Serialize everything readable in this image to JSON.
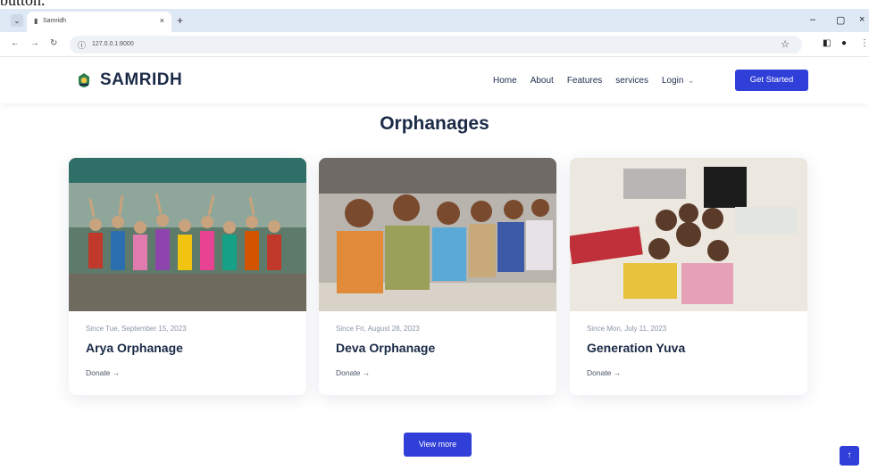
{
  "caption": "button.",
  "browser": {
    "tab_title": "Samridh",
    "tab_close": "×",
    "new_tab": "+",
    "url": "127.0.0.1:8000",
    "minimize": "–",
    "restore": "▢",
    "close": "×"
  },
  "header": {
    "brand": "SAMRIDH",
    "nav": [
      "Home",
      "About",
      "Features",
      "services",
      "Login"
    ],
    "login_chevron": "⌄",
    "cta": "Get Started"
  },
  "main": {
    "title": "Orphanages",
    "cards": [
      {
        "since": "Since Tue, September 15, 2023",
        "name": "Arya Orphanage",
        "donate": "Donate →"
      },
      {
        "since": "Since Fri, August 28, 2023",
        "name": "Deva Orphanage",
        "donate": "Donate →"
      },
      {
        "since": "Since Mon, July 11, 2023",
        "name": "Generation Yuva",
        "donate": "Donate →"
      }
    ],
    "view_more": "View more"
  },
  "back_to_top": "↑",
  "colors": {
    "accent": "#2f3fd8",
    "heading": "#1b2a47",
    "muted": "#8a94a6"
  }
}
